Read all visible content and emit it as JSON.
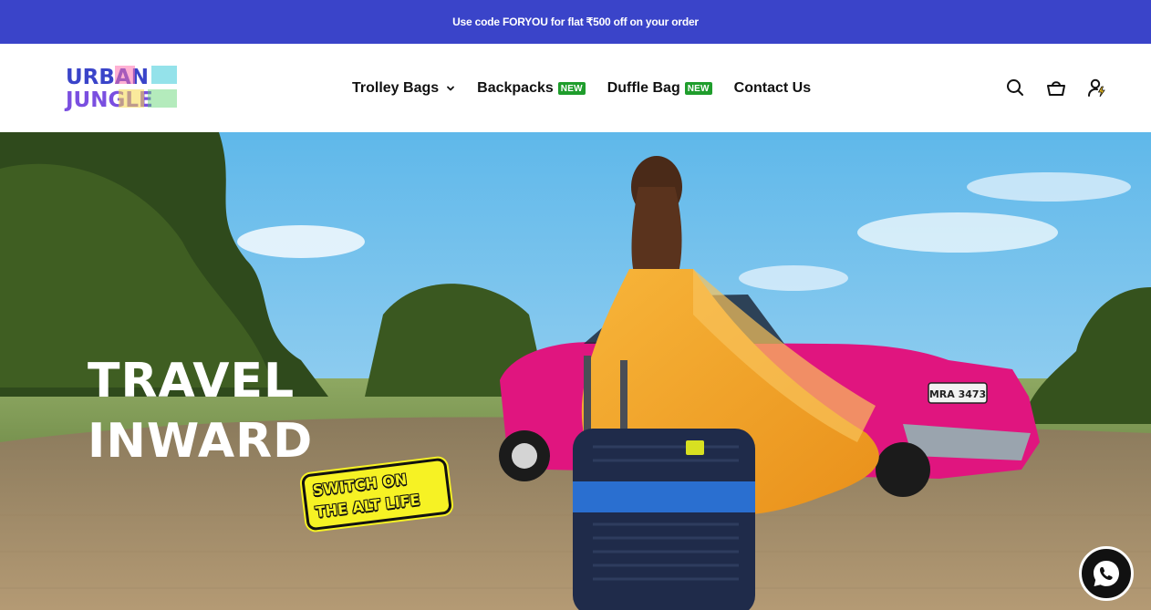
{
  "announcement": {
    "text": "Use code FORYOU for flat ₹500 off on your order"
  },
  "brand": {
    "logo_line1": "URBAN",
    "logo_line2": "JUNGLE"
  },
  "nav": {
    "items": [
      {
        "label": "Trolley Bags",
        "has_dropdown": true,
        "badge": ""
      },
      {
        "label": "Backpacks",
        "has_dropdown": false,
        "badge": "NEW"
      },
      {
        "label": "Duffle Bag",
        "has_dropdown": false,
        "badge": "NEW"
      },
      {
        "label": "Contact Us",
        "has_dropdown": false,
        "badge": ""
      }
    ]
  },
  "header_icons": [
    "search-icon",
    "cart-basket-icon",
    "account-icon"
  ],
  "hero": {
    "headline_line1": "TRAVEL",
    "headline_line2": "INWARD",
    "stamp_line1": "SWITCH ON",
    "stamp_line2": "THE ALT LIFE",
    "car_plate": "MRA 3473"
  },
  "colors": {
    "announcement_bg": "#3a44c9",
    "badge_new": "#1f9d2c",
    "stamp_yellow": "#f6f224",
    "car_pink": "#e0157f",
    "dress_orange": "#f4a62a"
  },
  "floating": {
    "icon": "whatsapp-icon"
  }
}
